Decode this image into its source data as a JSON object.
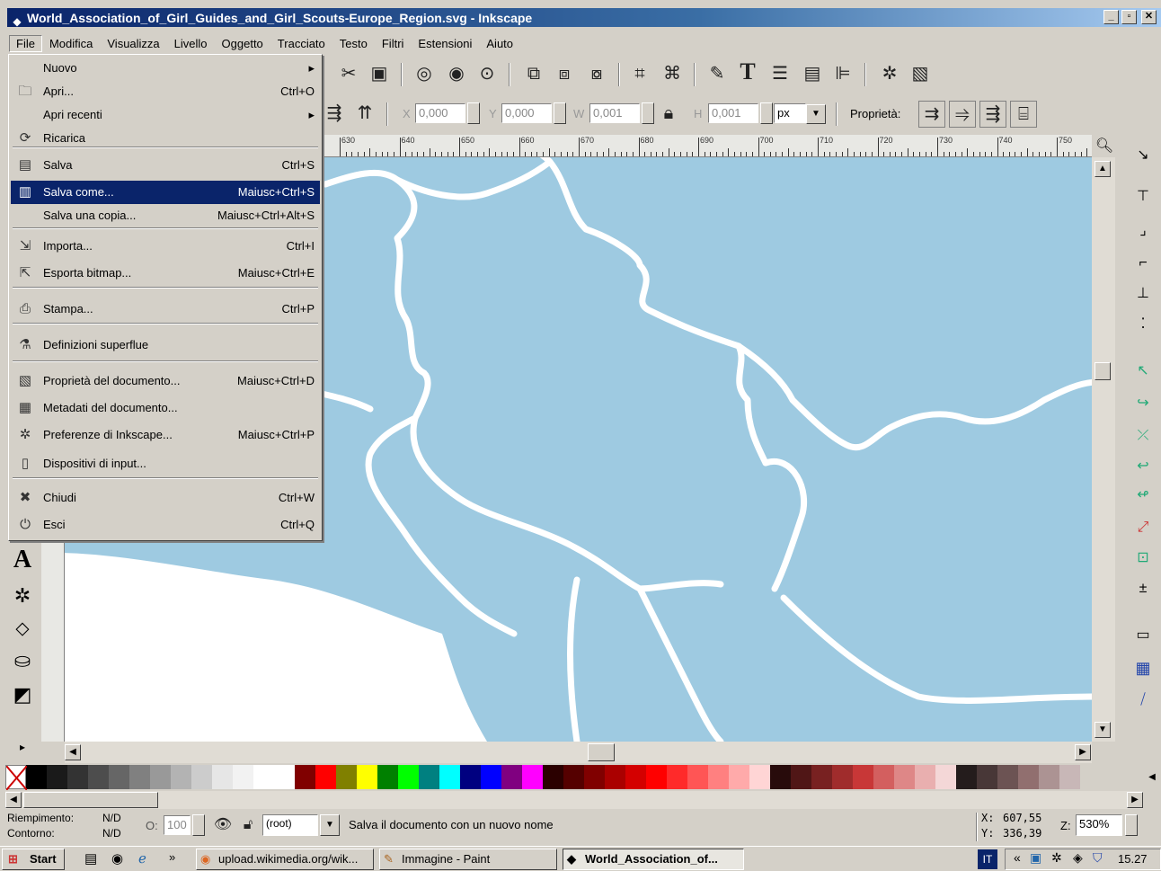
{
  "window": {
    "title": "World_Association_of_Girl_Guides_and_Girl_Scouts-Europe_Region.svg - Inkscape"
  },
  "menubar": [
    "File",
    "Modifica",
    "Visualizza",
    "Livello",
    "Oggetto",
    "Tracciato",
    "Testo",
    "Filtri",
    "Estensioni",
    "Aiuto"
  ],
  "file_menu": [
    {
      "icon": "",
      "label": "Nuovo",
      "shortcut": "",
      "submenu": true
    },
    {
      "icon": "folder-icon",
      "label": "Apri...",
      "shortcut": "Ctrl+O"
    },
    {
      "icon": "",
      "label": "Apri recenti",
      "shortcut": "",
      "submenu": true
    },
    {
      "icon": "reload-icon",
      "label": "Ricarica",
      "shortcut": ""
    },
    {
      "icon": "save-icon",
      "label": "Salva",
      "shortcut": "Ctrl+S"
    },
    {
      "icon": "save-as-icon",
      "label": "Salva come...",
      "shortcut": "Maiusc+Ctrl+S",
      "highlighted": true
    },
    {
      "icon": "",
      "label": "Salva una copia...",
      "shortcut": "Maiusc+Ctrl+Alt+S"
    },
    {
      "icon": "import-icon",
      "label": "Importa...",
      "shortcut": "Ctrl+I"
    },
    {
      "icon": "export-icon",
      "label": "Esporta bitmap...",
      "shortcut": "Maiusc+Ctrl+E"
    },
    {
      "icon": "print-icon",
      "label": "Stampa...",
      "shortcut": "Ctrl+P"
    },
    {
      "icon": "vacuum-icon",
      "label": "Definizioni superflue",
      "shortcut": ""
    },
    {
      "icon": "doc-properties-icon",
      "label": "Proprietà del documento...",
      "shortcut": "Maiusc+Ctrl+D"
    },
    {
      "icon": "metadata-icon",
      "label": "Metadati del documento...",
      "shortcut": ""
    },
    {
      "icon": "preferences-icon",
      "label": "Preferenze di Inkscape...",
      "shortcut": "Maiusc+Ctrl+P"
    },
    {
      "icon": "input-devices-icon",
      "label": "Dispositivi di input...",
      "shortcut": ""
    },
    {
      "icon": "close-icon",
      "label": "Chiudi",
      "shortcut": "Ctrl+W"
    },
    {
      "icon": "quit-icon",
      "label": "Esci",
      "shortcut": "Ctrl+Q"
    }
  ],
  "toolbar2": {
    "x_label": "X",
    "x_value": "0,000",
    "y_label": "Y",
    "y_value": "0,000",
    "w_label": "W",
    "w_value": "0,001",
    "h_label": "H",
    "h_value": "0,001",
    "unit": "px",
    "properties_label": "Proprietà:"
  },
  "ruler_ticks": [
    "630",
    "640",
    "650",
    "660",
    "670",
    "680",
    "690",
    "700",
    "710",
    "720",
    "730",
    "740",
    "750"
  ],
  "palette_colors": [
    "#000000",
    "#1a1a1a",
    "#333333",
    "#4d4d4d",
    "#666666",
    "#808080",
    "#999999",
    "#b3b3b3",
    "#cccccc",
    "#e6e6e6",
    "#f2f2f2",
    "#ffffff",
    "#ffffff",
    "#800000",
    "#ff0000",
    "#808000",
    "#ffff00",
    "#008000",
    "#00ff00",
    "#008080",
    "#00ffff",
    "#000080",
    "#0000ff",
    "#800080",
    "#ff00ff",
    "#2b0000",
    "#550000",
    "#800000",
    "#aa0000",
    "#d40000",
    "#ff0000",
    "#ff2a2a",
    "#ff5555",
    "#ff8080",
    "#ffaaaa",
    "#ffd5d5",
    "#280b0b",
    "#501616",
    "#782121",
    "#a02c2c",
    "#c83737",
    "#d35f5f",
    "#de8787",
    "#e9afaf",
    "#f4d7d7",
    "#241c1c",
    "#483737",
    "#6c5353",
    "#916f6f",
    "#ac9393",
    "#c8b7b7"
  ],
  "status": {
    "fill_label": "Riempimento:",
    "fill_value": "N/D",
    "stroke_label": "Contorno:",
    "stroke_value": "N/D",
    "opacity_label": "O:",
    "opacity_value": "100",
    "layer": "(root)",
    "message": "Salva il documento con un nuovo nome",
    "x_label": "X:",
    "x_coord": "607,55",
    "y_label": "Y:",
    "y_coord": "336,39",
    "zoom_label": "Z:",
    "zoom": "530%"
  },
  "taskbar": {
    "start": "Start",
    "tasks": [
      "upload.wikimedia.org/wik...",
      "Immagine - Paint",
      "World_Association_of..."
    ],
    "lang": "IT",
    "clock": "15.27",
    "more": "»"
  }
}
